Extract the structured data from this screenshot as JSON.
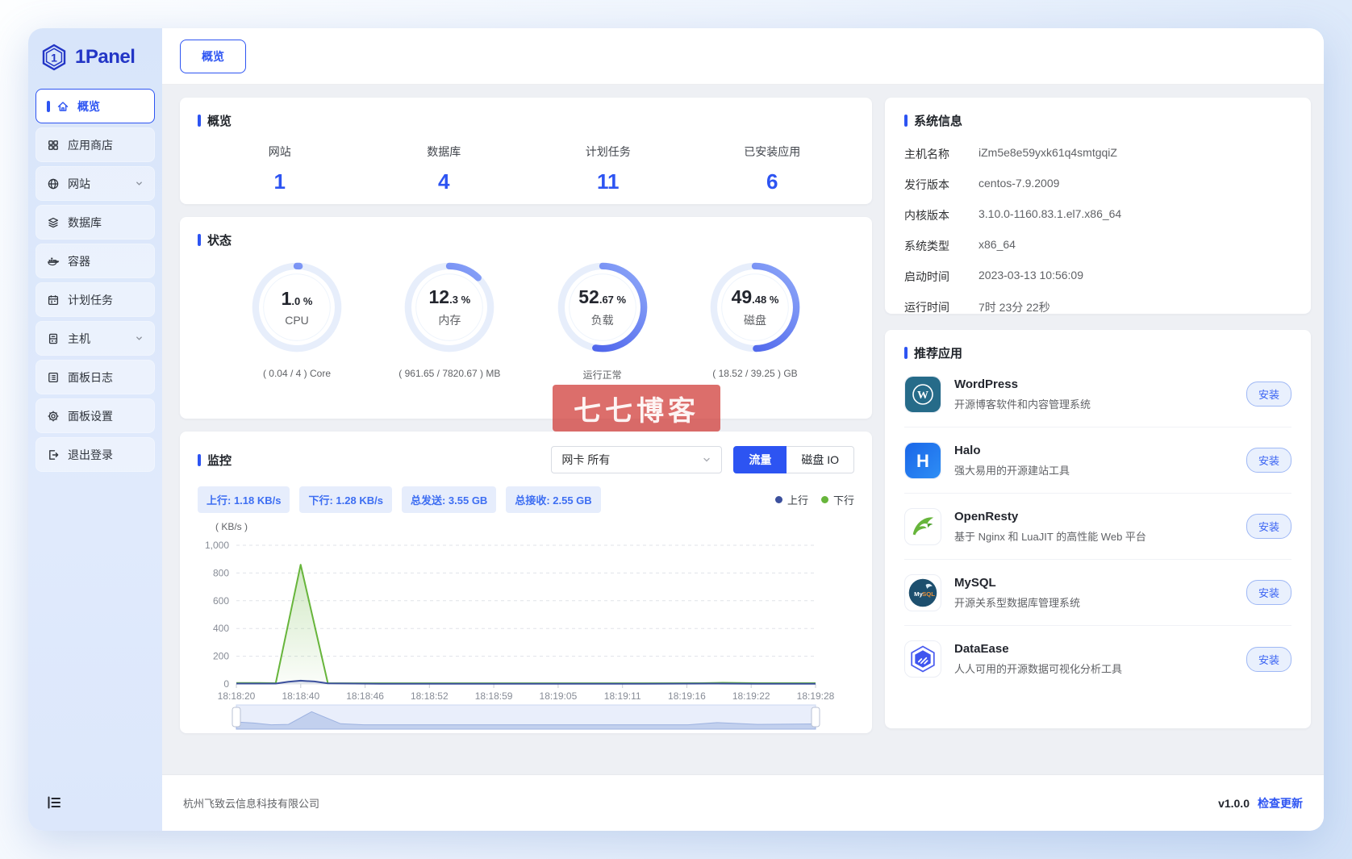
{
  "brand": {
    "name": "1Panel"
  },
  "topbar": {
    "tab": "概览"
  },
  "sidebar": {
    "items": [
      {
        "label": "概览",
        "active": true
      },
      {
        "label": "应用商店"
      },
      {
        "label": "网站",
        "chevron": true
      },
      {
        "label": "数据库"
      },
      {
        "label": "容器"
      },
      {
        "label": "计划任务"
      },
      {
        "label": "主机",
        "chevron": true
      },
      {
        "label": "面板日志"
      },
      {
        "label": "面板设置"
      },
      {
        "label": "退出登录"
      }
    ]
  },
  "overview": {
    "title": "概览",
    "stats": [
      {
        "label": "网站",
        "value": "1"
      },
      {
        "label": "数据库",
        "value": "4"
      },
      {
        "label": "计划任务",
        "value": "11"
      },
      {
        "label": "已安装应用",
        "value": "6"
      }
    ]
  },
  "status": {
    "title": "状态",
    "gauges": [
      {
        "int": "1",
        "frac": ".0 %",
        "label": "CPU",
        "sub": "( 0.04 / 4 ) Core",
        "percent": 1
      },
      {
        "int": "12",
        "frac": ".3 %",
        "label": "内存",
        "sub": "( 961.65 / 7820.67 ) MB",
        "percent": 12.3
      },
      {
        "int": "52",
        "frac": ".67 %",
        "label": "负载",
        "sub": "运行正常",
        "percent": 52.67
      },
      {
        "int": "49",
        "frac": ".48 %",
        "label": "磁盘",
        "sub": "( 18.52 / 39.25 ) GB",
        "percent": 49.48
      }
    ],
    "accent_color": "#3f55e8"
  },
  "monitor": {
    "title": "监控",
    "select_value": "网卡 所有",
    "btn_traffic": "流量",
    "btn_disk": "磁盘 IO",
    "chips": [
      "上行: 1.18 KB/s",
      "下行: 1.28 KB/s",
      "总发送: 3.55 GB",
      "总接收: 2.55 GB"
    ],
    "legend_up": "上行",
    "legend_down": "下行",
    "unit": "( KB/s )"
  },
  "chart_data": {
    "type": "area",
    "title": "网卡流量监控",
    "xlabel": "",
    "ylabel": "( KB/s )",
    "ylim": [
      0,
      1000
    ],
    "grid": true,
    "legend_position": "top-right",
    "x_ticks": [
      "18:18:20",
      "18:18:40",
      "18:18:46",
      "18:18:52",
      "18:18:59",
      "18:19:05",
      "18:19:11",
      "18:19:16",
      "18:19:22",
      "18:19:28"
    ],
    "y_ticks": [
      {
        "v": 0,
        "label": "0"
      },
      {
        "v": 200,
        "label": "200"
      },
      {
        "v": 400,
        "label": "400"
      },
      {
        "v": 600,
        "label": "600"
      },
      {
        "v": 800,
        "label": "800"
      },
      {
        "v": 1000,
        "label": "1,000"
      }
    ],
    "series": [
      {
        "name": "上行",
        "color": "#3c509d",
        "points": [
          [
            0,
            3
          ],
          [
            0.05,
            3
          ],
          [
            0.068,
            3
          ],
          [
            0.09,
            16
          ],
          [
            0.111,
            24
          ],
          [
            0.135,
            18
          ],
          [
            0.158,
            4
          ],
          [
            0.25,
            2
          ],
          [
            0.4,
            2
          ],
          [
            0.55,
            2
          ],
          [
            0.7,
            2
          ],
          [
            0.82,
            3
          ],
          [
            0.9,
            2
          ],
          [
            1,
            2
          ]
        ]
      },
      {
        "name": "下行",
        "color": "#67b53b",
        "points": [
          [
            0,
            7
          ],
          [
            0.04,
            7
          ],
          [
            0.068,
            6
          ],
          [
            0.111,
            860
          ],
          [
            0.158,
            6
          ],
          [
            0.25,
            5
          ],
          [
            0.4,
            5
          ],
          [
            0.55,
            5
          ],
          [
            0.7,
            5
          ],
          [
            0.8,
            6
          ],
          [
            0.84,
            9
          ],
          [
            0.9,
            6
          ],
          [
            1,
            6
          ]
        ]
      }
    ],
    "brush": [
      [
        0,
        0.33
      ],
      [
        0.03,
        0.28
      ],
      [
        0.06,
        0.2
      ],
      [
        0.09,
        0.22
      ],
      [
        0.13,
        0.8
      ],
      [
        0.18,
        0.25
      ],
      [
        0.22,
        0.2
      ],
      [
        0.35,
        0.2
      ],
      [
        0.5,
        0.2
      ],
      [
        0.65,
        0.2
      ],
      [
        0.78,
        0.2
      ],
      [
        0.83,
        0.3
      ],
      [
        0.9,
        0.22
      ],
      [
        1,
        0.24
      ]
    ]
  },
  "system_info": {
    "title": "系统信息",
    "rows": [
      {
        "label": "主机名称",
        "value": "iZm5e8e59yxk61q4smtgqiZ"
      },
      {
        "label": "发行版本",
        "value": "centos-7.9.2009"
      },
      {
        "label": "内核版本",
        "value": "3.10.0-1160.83.1.el7.x86_64"
      },
      {
        "label": "系统类型",
        "value": "x86_64"
      },
      {
        "label": "启动时间",
        "value": "2023-03-13 10:56:09"
      },
      {
        "label": "运行时间",
        "value": "7时 23分 22秒"
      }
    ]
  },
  "apps": {
    "title": "推荐应用",
    "install_label": "安装",
    "items": [
      {
        "name": "WordPress",
        "desc": "开源博客软件和内容管理系统"
      },
      {
        "name": "Halo",
        "desc": "强大易用的开源建站工具"
      },
      {
        "name": "OpenResty",
        "desc": "基于 Nginx 和 LuaJIT 的高性能 Web 平台"
      },
      {
        "name": "MySQL",
        "desc": "开源关系型数据库管理系统"
      },
      {
        "name": "DataEase",
        "desc": "人人可用的开源数据可视化分析工具"
      }
    ]
  },
  "footer": {
    "company": "杭州飞致云信息科技有限公司",
    "version": "v1.0.0",
    "update": "检查更新"
  },
  "watermark": {
    "text": "七七博客",
    "color": "#d03e3a"
  }
}
